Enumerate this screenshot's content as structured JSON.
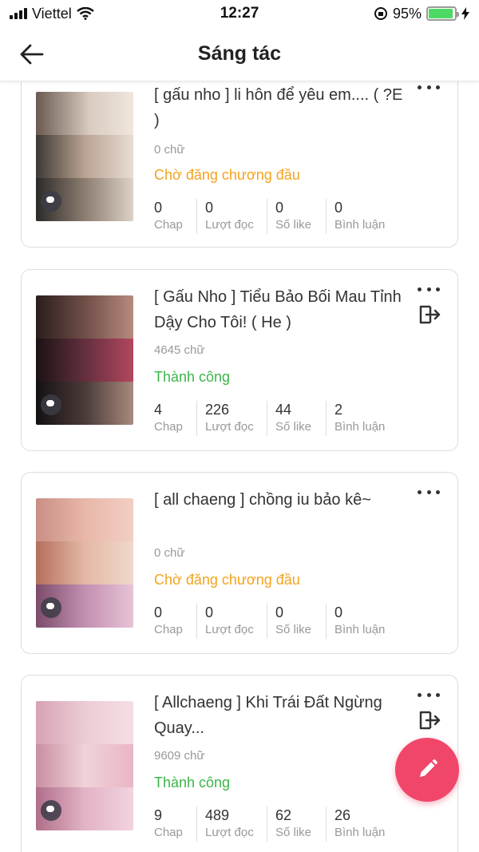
{
  "status_bar": {
    "carrier": "Viettel",
    "time": "12:27",
    "battery": "95%",
    "battery_level": 0.95
  },
  "header": {
    "title": "Sáng tác"
  },
  "colors": {
    "pending": "#f4a21d",
    "success": "#3bb54a",
    "fab": "#f0466a"
  },
  "stories": [
    {
      "title": "[ gấu nho ] li hôn để yêu em.... ( ?E )",
      "words": "0 chữ",
      "status": "Chờ đăng chương đầu",
      "status_type": "pending",
      "stats": [
        {
          "value": "0",
          "label": "Chap"
        },
        {
          "value": "0",
          "label": "Lượt đọc"
        },
        {
          "value": "0",
          "label": "Số like"
        },
        {
          "value": "0",
          "label": "Bình luận"
        }
      ]
    },
    {
      "title": "[ Gấu Nho ] Tiểu Bảo Bối Mau Tỉnh Dậy Cho Tôi! ( He )",
      "words": "4645 chữ",
      "status": "Thành công",
      "status_type": "success",
      "stats": [
        {
          "value": "4",
          "label": "Chap"
        },
        {
          "value": "226",
          "label": "Lượt đọc"
        },
        {
          "value": "44",
          "label": "Số like"
        },
        {
          "value": "2",
          "label": "Bình luận"
        }
      ]
    },
    {
      "title": "[ all chaeng ] chồng iu bảo kê~",
      "words": "0 chữ",
      "status": "Chờ đăng chương đầu",
      "status_type": "pending",
      "stats": [
        {
          "value": "0",
          "label": "Chap"
        },
        {
          "value": "0",
          "label": "Lượt đọc"
        },
        {
          "value": "0",
          "label": "Số like"
        },
        {
          "value": "0",
          "label": "Bình luận"
        }
      ]
    },
    {
      "title": "[ Allchaeng ] Khi Trái Đất Ngừng Quay...",
      "words": "9609 chữ",
      "status": "Thành công",
      "status_type": "success",
      "stats": [
        {
          "value": "9",
          "label": "Chap"
        },
        {
          "value": "489",
          "label": "Lượt đọc"
        },
        {
          "value": "62",
          "label": "Số like"
        },
        {
          "value": "26",
          "label": "Bình luận"
        }
      ]
    }
  ]
}
